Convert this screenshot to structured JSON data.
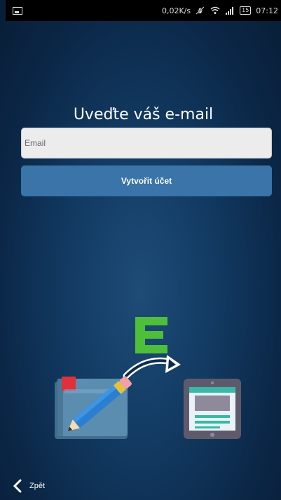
{
  "status_bar": {
    "net_speed": "0,02K/s",
    "battery": "15",
    "time": "07:12"
  },
  "main": {
    "heading": "Uveďte váš e-mail",
    "email_placeholder": "Email",
    "email_value": "",
    "create_button_label": "Vytvořit účet"
  },
  "illustration": {
    "letter": "E",
    "letter_color": "#4fbf3a",
    "notebook_icon": "notebook-pencil-icon",
    "arrow_icon": "curved-arrow-icon",
    "tablet_icon": "tablet-icon"
  },
  "bottom_nav": {
    "back_label": "Zpět"
  },
  "colors": {
    "background": "#0b2747",
    "button": "#3a74a8",
    "field": "#ececec"
  }
}
